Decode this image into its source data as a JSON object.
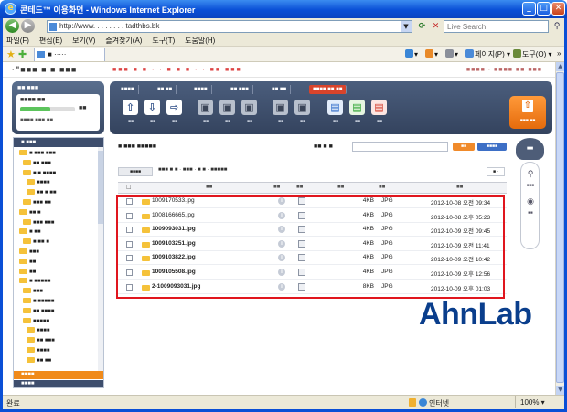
{
  "window": {
    "title": "콘테드™ 이용화면 - Windows Internet Explorer",
    "controls": {
      "minimize": "_",
      "maximize": "□",
      "close": "✕"
    }
  },
  "addressbar": {
    "url": "http://www.   .   . .   .   .     .    .     tadthbs.bk",
    "search_placeholder": "Live Search"
  },
  "menu": [
    "파일(F)",
    "편집(E)",
    "보기(V)",
    "즐겨찾기(A)",
    "도구(T)",
    "도움말(H)"
  ],
  "favbar": {
    "tab_label": "■ ·····",
    "commands": {
      "page": "페이지(P) ▾",
      "tools": "도구(O) ▾",
      "chevron": "»"
    }
  },
  "site": {
    "logo": "·\"■■■ ■ ■ ■■■",
    "promo": "■■■ ■ ■ · · ■ ■ ■ · · ■■ ■■■",
    "top_links": "■■■■ · ■■■■ ■■ ■■■"
  },
  "storage": {
    "title": "■■ ■■■",
    "label": "■■■■ ■■",
    "used_fraction": 0.55,
    "unit": "■■",
    "detail": "■■■■ ■■■ ■■"
  },
  "toolbar": {
    "tabs": [
      "■■■■",
      "■■ ■■",
      "■■■■",
      "■■ ■■■",
      "■■ ■■",
      "■■■■ ■■ ■■"
    ],
    "buttons": [
      {
        "icon": "⇧",
        "caption": "■■"
      },
      {
        "icon": "⇩",
        "caption": "■■"
      },
      {
        "icon": "⇨",
        "caption": "■■"
      },
      {
        "icon": "▣",
        "caption": "■■"
      },
      {
        "icon": "▣",
        "caption": "■■"
      },
      {
        "icon": "▣",
        "caption": "■■"
      },
      {
        "icon": "▣",
        "caption": "■■"
      },
      {
        "icon": "▣",
        "caption": "■■"
      },
      {
        "icon": "▤",
        "caption": "■■"
      },
      {
        "icon": "▤",
        "caption": "■■"
      },
      {
        "icon": "▤",
        "caption": "■■"
      }
    ],
    "upload_label": "■■■ ■■"
  },
  "tree": {
    "header": "■ ■■■",
    "items": [
      "■ ■■■ ■■■",
      "■■ ■■■",
      "■ ■ ■■■■",
      "■■■■",
      "■■ ■ ■■",
      "■■■ ■■",
      "■■ ■",
      "■■■ ■■■",
      "■ ■■",
      "■ ■■ ■",
      "■■■",
      "■■",
      "■■",
      "■ ■■■■■",
      "■■■",
      "■ ■■■■■",
      "■■ ■■■■",
      "■■■■■",
      "■■■■",
      "■■ ■■■",
      "■■■■",
      "■■ ■■"
    ],
    "footer_active": "■■■■",
    "footer": "■■■■"
  },
  "main": {
    "title": "■ ■■■ ■■■■■",
    "count": "■■ ■ ■",
    "btn_orange": "■■",
    "btn_blue": "■■■■",
    "path_button": "■■■■",
    "path_text": "■■■ ■ ■ · ■■■ · ■ ■ · ■■■■■",
    "path_right": "■ ·",
    "columns": {
      "name": "■■",
      "info": "■■",
      "memo": "■■",
      "size": "■■",
      "type": "■■",
      "date": "■■"
    }
  },
  "files": [
    {
      "name": "1009170533.jpg",
      "size": "4KB",
      "type": "JPG",
      "date": "2012-10-08 오전 09:34",
      "bold": false
    },
    {
      "name": "1008166665.jpg",
      "size": "4KB",
      "type": "JPG",
      "date": "2012-10-08 오후 05:23",
      "bold": false
    },
    {
      "name": "1009093031.jpg",
      "size": "4KB",
      "type": "JPG",
      "date": "2012-10-09 오전 09:45",
      "bold": true
    },
    {
      "name": "1009103251.jpg",
      "size": "4KB",
      "type": "JPG",
      "date": "2012-10-09 오전 11:41",
      "bold": true
    },
    {
      "name": "1009103822.jpg",
      "size": "4KB",
      "type": "JPG",
      "date": "2012-10-09 오전 10:42",
      "bold": true
    },
    {
      "name": "1009105508.jpg",
      "size": "4KB",
      "type": "JPG",
      "date": "2012-10-09 오후 12:56",
      "bold": true
    },
    {
      "name": "2-1009093031.jpg",
      "size": "8KB",
      "type": "JPG",
      "date": "2012-10-09 오후 01:03",
      "bold": true
    }
  ],
  "quick": {
    "top": "■■",
    "items": [
      {
        "icon": "⚲",
        "label": "■■■"
      },
      {
        "icon": "◉",
        "label": "■■"
      }
    ]
  },
  "watermark": "AhnLab",
  "status": {
    "text": "완료",
    "zone": "인터넷",
    "zoom": "100% ▾"
  },
  "colors": {
    "titlebar": "#0a4fd6",
    "highlight": "#e0161e",
    "upload": "#f08a1a",
    "brand": "#0a3e8c"
  }
}
